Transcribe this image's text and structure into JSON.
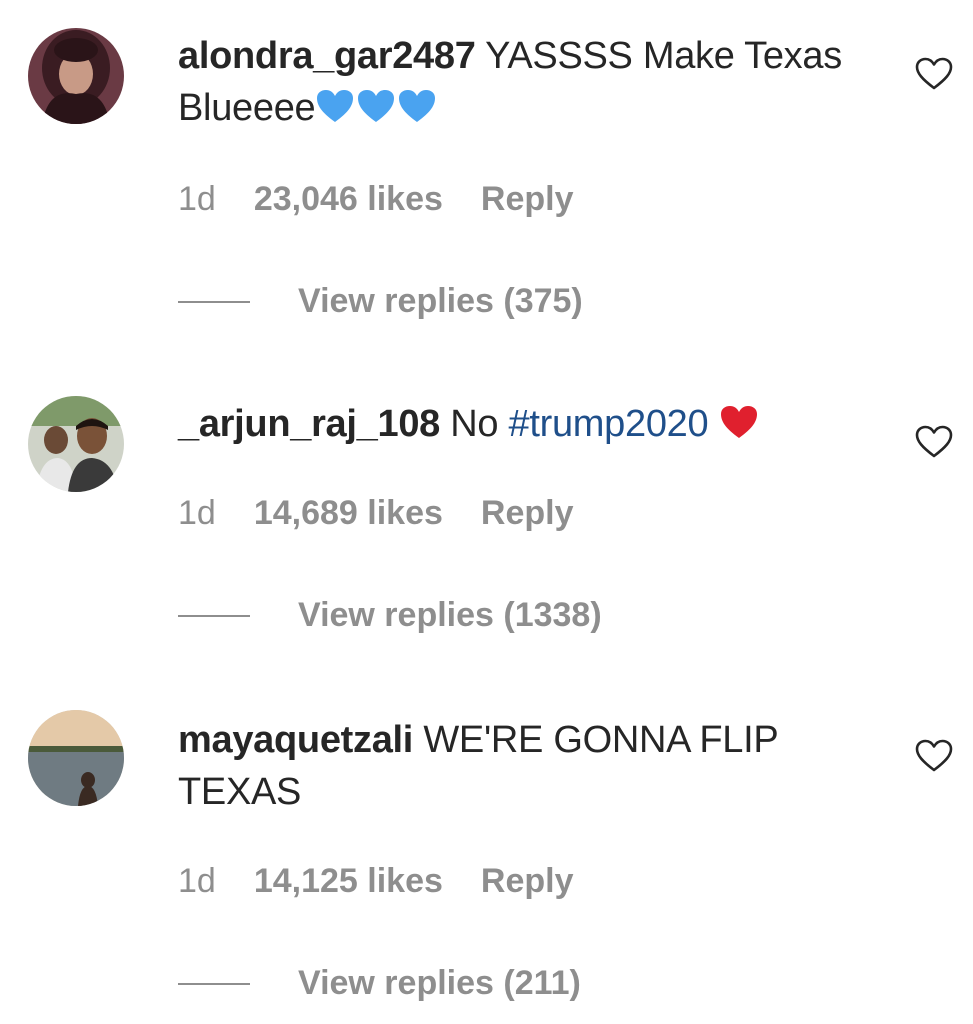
{
  "comments": [
    {
      "username": "alondra_gar2487",
      "text": "YASSSS Make Texas Blueeee",
      "emoji": "blue-hearts",
      "time": "1d",
      "likes": "23,046 likes",
      "reply_label": "Reply",
      "view_replies": "View replies (375)"
    },
    {
      "username": "_arjun_raj_108",
      "text_prefix": "No",
      "hashtag": "#trump2020",
      "emoji": "red-heart",
      "time": "1d",
      "likes": "14,689 likes",
      "reply_label": "Reply",
      "view_replies": "View replies (1338)"
    },
    {
      "username": "mayaquetzali",
      "text": "WE'RE GONNA FLIP TEXAS",
      "time": "1d",
      "likes": "14,125 likes",
      "reply_label": "Reply",
      "view_replies": "View replies (211)"
    }
  ],
  "colors": {
    "text": "#262626",
    "meta": "#8e8e8e",
    "hashtag": "#1f4f8a",
    "blue_heart": "#4aa3f0",
    "red_heart": "#e0202e"
  },
  "icons": {
    "like": "heart-outline-icon"
  }
}
